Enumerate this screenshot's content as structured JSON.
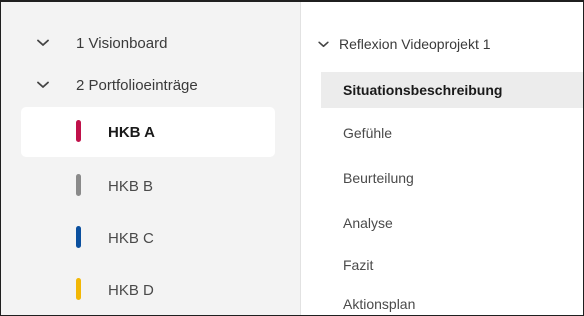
{
  "left_nav": {
    "folders": [
      {
        "label": "1 Visionboard",
        "icon": "chevron-down-icon"
      },
      {
        "label": "2 Portfolioeinträge",
        "icon": "chevron-down-icon"
      }
    ],
    "entries": [
      {
        "label": "HKB A",
        "color": "#c0114a",
        "selected": true
      },
      {
        "label": "HKB B",
        "color": "#8a8a8a",
        "selected": false
      },
      {
        "label": "HKB C",
        "color": "#0a4f9e",
        "selected": false
      },
      {
        "label": "HKB D",
        "color": "#f2b705",
        "selected": false
      }
    ]
  },
  "right_nav": {
    "section_title": "Reflexion Videoprojekt 1",
    "section_icon": "chevron-down-icon",
    "items": [
      {
        "label": "Situationsbeschreibung",
        "active": true
      },
      {
        "label": "Gefühle",
        "active": false
      },
      {
        "label": "Beurteilung",
        "active": false
      },
      {
        "label": "Analyse",
        "active": false
      },
      {
        "label": "Fazit",
        "active": false
      },
      {
        "label": "Aktionsplan",
        "active": false
      }
    ]
  }
}
